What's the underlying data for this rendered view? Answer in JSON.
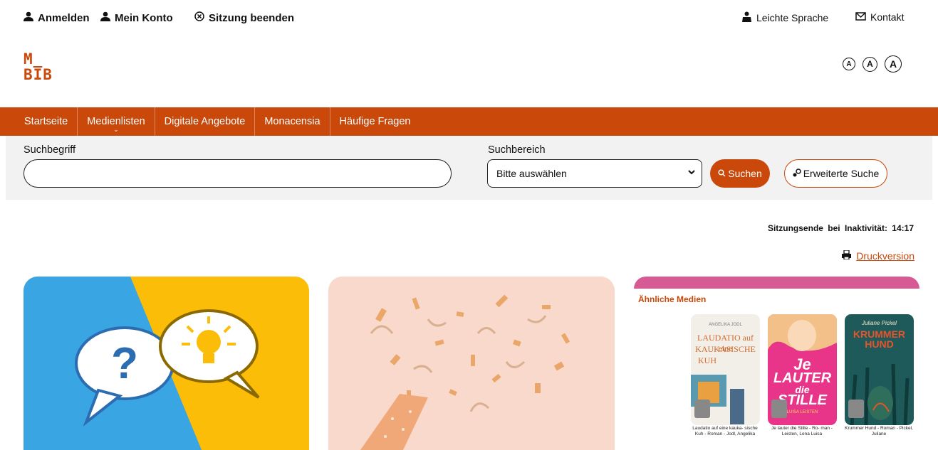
{
  "topbar": {
    "login": "Anmelden",
    "account": "Mein Konto",
    "end_session": "Sitzung beenden",
    "easy_language": "Leichte Sprache",
    "contact": "Kontakt"
  },
  "logo": {
    "line1": "M_",
    "line2": "BIB"
  },
  "font_size_controls": [
    "A",
    "A",
    "A"
  ],
  "nav": {
    "items": [
      {
        "label": "Startseite"
      },
      {
        "label": "Medienlisten"
      },
      {
        "label": "Digitale Angebote"
      },
      {
        "label": "Monacensia"
      },
      {
        "label": "Häufige Fragen"
      }
    ]
  },
  "search": {
    "term_label": "Suchbegriff",
    "term_value": "",
    "scope_label": "Suchbereich",
    "scope_selected": "Bitte auswählen",
    "search_button": "Suchen",
    "advanced_button": "Erweiterte Suche"
  },
  "session_timeout": "Sitzungsende bei Inaktivität: 14:17",
  "print_link": "Druckversion",
  "similar_media": {
    "title": "Ähnliche Medien",
    "books": [
      {
        "caption": "Laudatio auf eine kauka- sische Kuh - Roman - Jodl, Angelika",
        "cover_lines": [
          "ANGELIKA JODL",
          "LAUDATIO auf eine",
          "KAUKASISCHE",
          "KUH"
        ]
      },
      {
        "caption": "Je lauter die Stille - Ro- man - Leisten, Lena Luisa",
        "cover_lines": [
          "Je",
          "LAUTER",
          "die",
          "STILLE",
          "LUISA LEISTEN"
        ]
      },
      {
        "caption": "Krummer Hund - Roman - Pickel, Juliane",
        "cover_lines": [
          "Juliane Pickel",
          "KRUMMER",
          "HUND"
        ]
      }
    ]
  },
  "colors": {
    "accent": "#c9480a",
    "pink_band": "#d65a93",
    "search_bg": "#f2f2f2"
  }
}
